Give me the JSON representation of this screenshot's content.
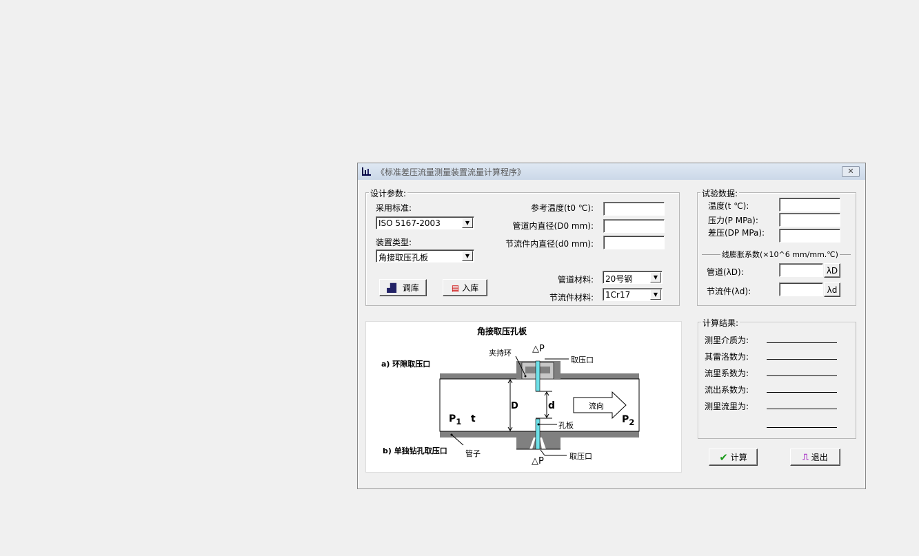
{
  "window": {
    "title": "《标准差压流量测量装置流量计算程序》",
    "close_icon": "close-icon",
    "app_icon": "chart-icon"
  },
  "design": {
    "legend": "设计参数:",
    "standard_label": "采用标准:",
    "standard_value": "ISO 5167-2003",
    "device_label": "装置类型:",
    "device_value": "角接取压孔板",
    "ref_temp_label": "参考温度(t0 ℃):",
    "ref_temp_value": "",
    "pipe_diam_label": "管道内直径(D0 mm):",
    "pipe_diam_value": "",
    "throttle_diam_label": "节流件内直径(d0 mm):",
    "throttle_diam_value": "",
    "pipe_mat_label": "管道材料:",
    "pipe_mat_value": "20号钢",
    "throttle_mat_label": "节流件材料:",
    "throttle_mat_value": "1Cr17",
    "load_button": "调库",
    "save_button": "入库"
  },
  "test": {
    "legend": "试验数据:",
    "temp_label": "温度(t ℃):",
    "pressure_label": "压力(P MPa):",
    "dp_label": "差压(DP MPa):",
    "temp_value": "",
    "pressure_value": "",
    "dp_value": "",
    "expansion_label": "线膨胀系数(×10^6 mm/mm.℃)",
    "pipe_label": "管道(λD):",
    "pipe_btn": "λD",
    "throttle_label": "节流件(λd):",
    "throttle_btn": "λd",
    "pipe_value": "",
    "throttle_value": ""
  },
  "results": {
    "legend": "计算结果:",
    "items": [
      "测里介质为:",
      "其雷洛数为:",
      "流里系数为:",
      "流出系数为:",
      "测里流里为:"
    ]
  },
  "buttons": {
    "calc": "计算",
    "exit": "退出"
  },
  "diagram": {
    "title": "角接取压孔板",
    "dp_top": "△P",
    "dp_bottom": "△P",
    "clamp_ring": "夹持环",
    "tap_top": "取压口",
    "tap_bottom": "取压口",
    "a_label": "a) 环隙取压口",
    "b_label": "b) 单独钻孔取压口",
    "D": "D",
    "d": "d",
    "flow": "流向",
    "plate": "孔板",
    "P1": "P",
    "P1_sub": "1",
    "t": "t",
    "P2": "P",
    "P2_sub": "2",
    "pipe": "管子",
    "plate_color": "#6ee0e8",
    "wall_color": "#808080"
  }
}
